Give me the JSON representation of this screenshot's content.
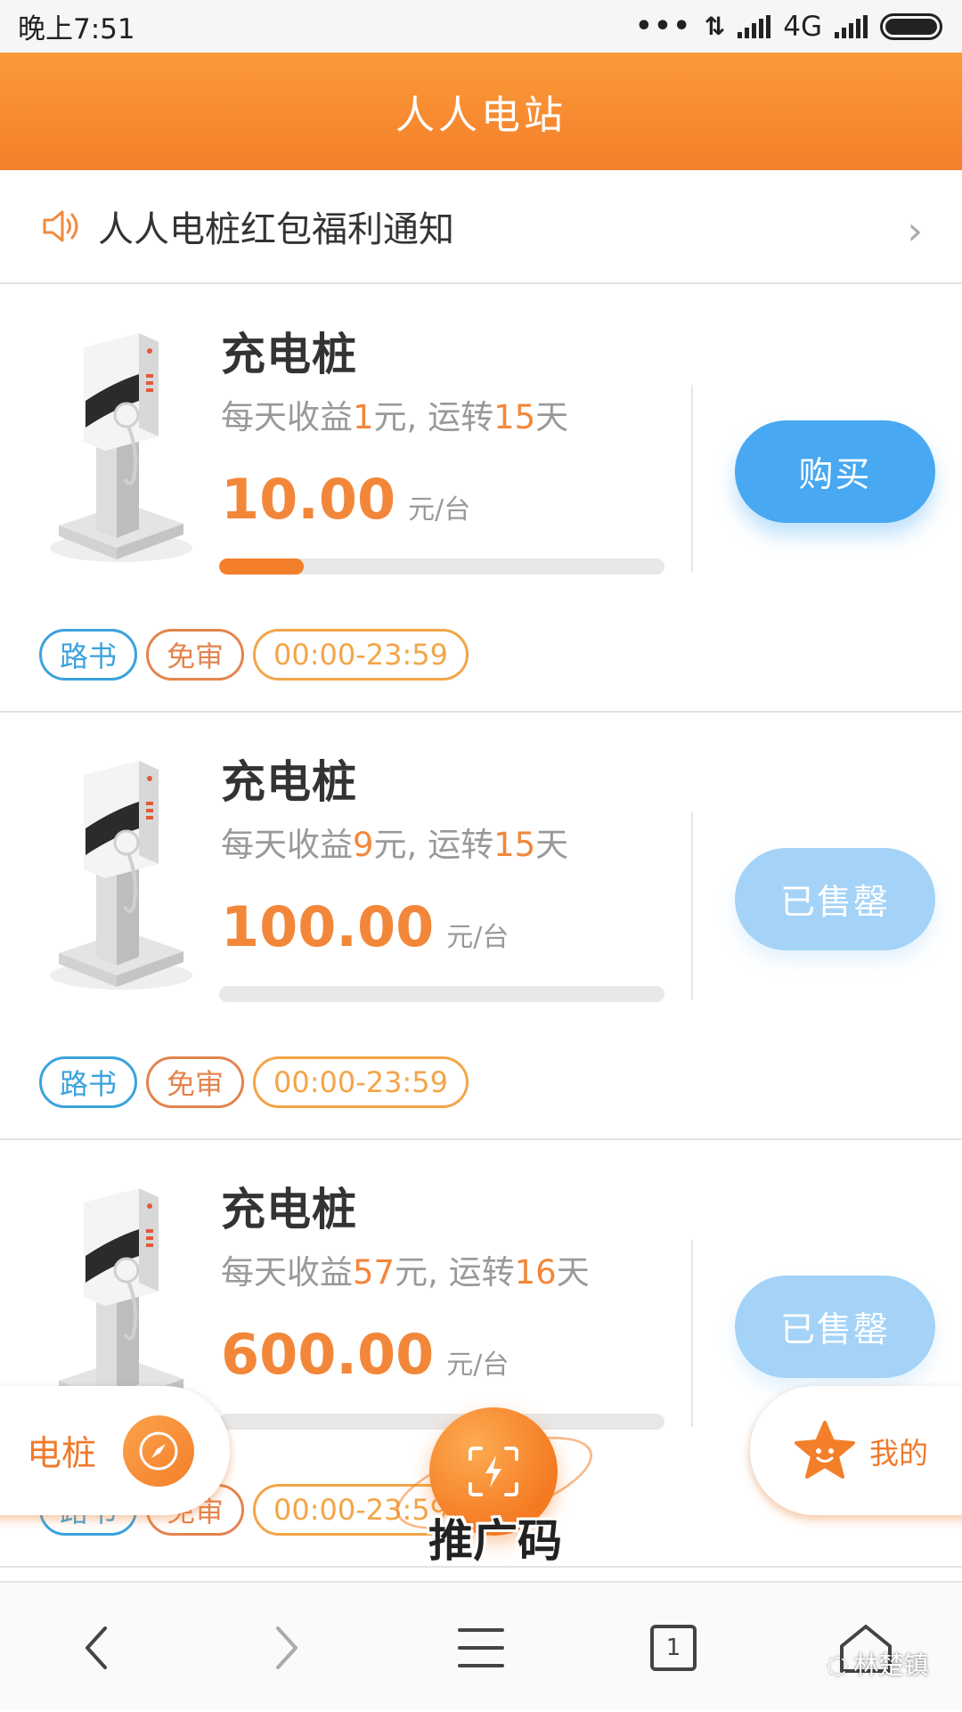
{
  "status_bar": {
    "time": "晚上7:51",
    "network": "4G"
  },
  "header": {
    "title": "人人电站"
  },
  "notice": {
    "icon": "speaker-icon",
    "text": "人人电桩红包福利通知",
    "chevron": "›"
  },
  "products": [
    {
      "title": "充电桩",
      "desc_prefix": "每天收益",
      "daily_income": "1",
      "desc_mid": "元, 运转",
      "days": "15",
      "desc_suffix": "天",
      "price": "10.00",
      "unit": "元/台",
      "progress": 0.19,
      "button": "购买",
      "button_state": "available",
      "tags": [
        "路书",
        "免审",
        "00:00-23:59"
      ]
    },
    {
      "title": "充电桩",
      "desc_prefix": "每天收益",
      "daily_income": "9",
      "desc_mid": "元, 运转",
      "days": "15",
      "desc_suffix": "天",
      "price": "100.00",
      "unit": "元/台",
      "progress": 0,
      "button": "已售罄",
      "button_state": "sold_out",
      "tags": [
        "路书",
        "免审",
        "00:00-23:59"
      ]
    },
    {
      "title": "充电桩",
      "desc_prefix": "每天收益",
      "daily_income": "57",
      "desc_mid": "元, 运转",
      "days": "16",
      "desc_suffix": "天",
      "price": "600.00",
      "unit": "元/台",
      "progress": 0,
      "button": "已售罄",
      "button_state": "sold_out",
      "tags": [
        "路书",
        "免审",
        "00:00-23:59"
      ]
    }
  ],
  "bottom_nav": {
    "left_label": "电桩",
    "left_icon": "compass-icon",
    "center_label": "推广码",
    "center_icon": "scan-bolt-icon",
    "right_label": "我的",
    "right_icon": "star-icon"
  },
  "browser_bar": {
    "tab_count": "1"
  },
  "watermark": "林楚镇",
  "colors": {
    "accent": "#f47f2a",
    "button_blue": "#48a8f2",
    "button_sold": "#a4d3f7",
    "tag_blue": "#3ba3dc",
    "tag_red": "#e4844e",
    "tag_orange": "#f3a548"
  }
}
